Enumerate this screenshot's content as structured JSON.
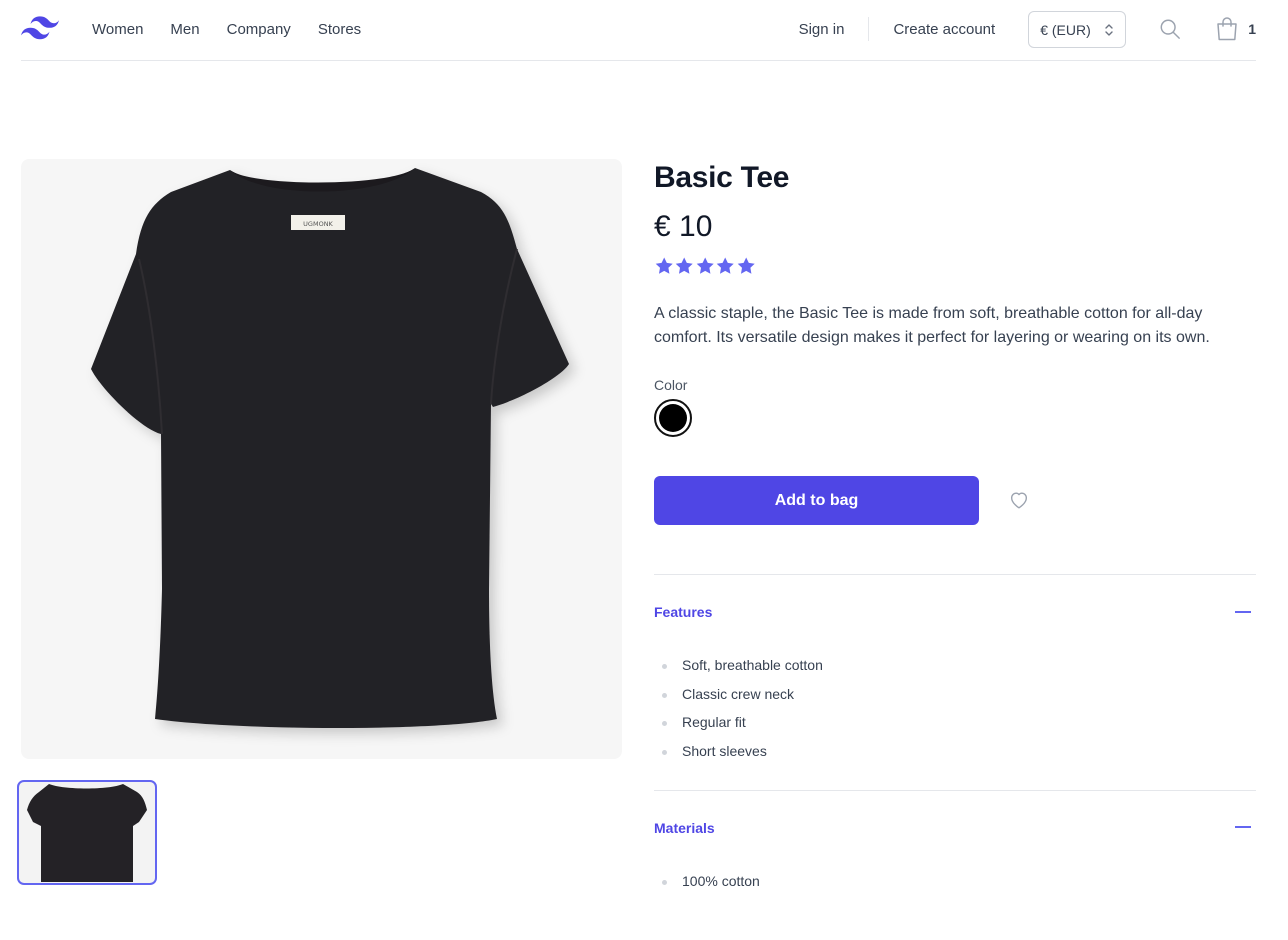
{
  "header": {
    "logo_icon": "tailwind-logo-icon",
    "nav": [
      "Women",
      "Men",
      "Company",
      "Stores"
    ],
    "sign_in": "Sign in",
    "create_account": "Create account",
    "currency": "€ (EUR)",
    "bag_count": "1"
  },
  "product": {
    "title": "Basic Tee",
    "price": "€ 10",
    "rating": 5,
    "rating_max": 5,
    "description": "A classic staple, the Basic Tee is made from soft, breathable cotton for all-day comfort. Its versatile design makes it perfect for layering or wearing on its own.",
    "color_label": "Color",
    "selected_color": "#000000",
    "add_to_bag": "Add to bag",
    "shirt_label": "UGMONK"
  },
  "accordions": [
    {
      "title": "Features",
      "items": [
        "Soft, breathable cotton",
        "Classic crew neck",
        "Regular fit",
        "Short sleeves"
      ]
    },
    {
      "title": "Materials",
      "items": [
        "100% cotton"
      ]
    }
  ],
  "colors": {
    "accent": "#4f46e5",
    "star": "#6366f1"
  }
}
